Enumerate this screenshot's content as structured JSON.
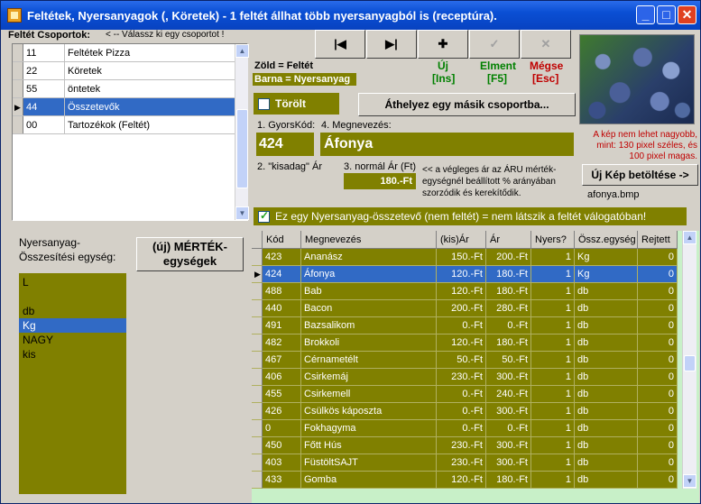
{
  "window": {
    "title": "Feltétek, Nyersanyagok (, Köretek)      - 1 feltét állhat több nyersanyagból is (receptúra).",
    "minimize": "_",
    "maximize": "□",
    "close": "✕"
  },
  "groups": {
    "label": "Feltét Csoportok:",
    "hint": "< -- Válassz ki egy csoportot !",
    "rows": [
      {
        "code": "11",
        "name": "Feltétek Pizza"
      },
      {
        "code": "22",
        "name": "Köretek"
      },
      {
        "code": "55",
        "name": "öntetek"
      },
      {
        "code": "44",
        "name": "Összetevők"
      },
      {
        "code": "00",
        "name": "Tartozékok (Feltét)"
      }
    ],
    "selected_index": 3
  },
  "nav": {
    "first": "|◀",
    "next": "▶|",
    "new": "✚",
    "save": "✓",
    "cancel": "✕"
  },
  "legend": {
    "green": "Zöld = Feltét",
    "brown": "Barna = Nyersanyag"
  },
  "actions": {
    "new_label": "Új",
    "new_key": "[Ins]",
    "save_label": "Elment",
    "save_key": "[F5]",
    "cancel_label": "Mégse",
    "cancel_key": "[Esc]"
  },
  "deleted_label": "Törölt",
  "move_button": "Áthelyez egy másik csoportba...",
  "image_note": "A kép nem lehet nagyobb, mint:  130 pixel széles, és 100 pixel magas.",
  "load_image_button": "Új Kép betöltése ->",
  "image_file": "afonya.bmp",
  "form": {
    "code_label": "1. GyorsKód:",
    "code_value": "424",
    "name_label": "4. Megnevezés:",
    "name_value": "Áfonya",
    "small_price_label": "2. \"kisadag\" Ár",
    "normal_price_label": "3. normál Ár (Ft)",
    "normal_price_value": "180.-Ft",
    "price_note": "<< a végleges ár az ÁRU mérték-egységnél beállított % arányában szorzódik és kerekítődik."
  },
  "raw_material_checkbox": "Ez egy Nyersanyag-összetevő (nem feltét) = nem látszik a feltét válogatóban!",
  "units": {
    "label": "Nyersanyag-Összesítési egység:",
    "button": "(új) MÉRTÉK-egységek",
    "items": [
      "L",
      "",
      "db",
      "Kg",
      "NAGY",
      "kis"
    ],
    "selected_index": 3
  },
  "grid": {
    "columns": [
      "Kód",
      "Megnevezés",
      "(kis)Ár",
      "Ár",
      "Nyers?",
      "Össz.egység",
      "Rejtett"
    ],
    "rows": [
      [
        "423",
        "Ananász",
        "150.-Ft",
        "200.-Ft",
        "1",
        "Kg",
        "0"
      ],
      [
        "424",
        "Áfonya",
        "120.-Ft",
        "180.-Ft",
        "1",
        "Kg",
        "0"
      ],
      [
        "488",
        "Bab",
        "120.-Ft",
        "180.-Ft",
        "1",
        "db",
        "0"
      ],
      [
        "440",
        "Bacon",
        "200.-Ft",
        "280.-Ft",
        "1",
        "db",
        "0"
      ],
      [
        "491",
        "Bazsalikom",
        "0.-Ft",
        "0.-Ft",
        "1",
        "db",
        "0"
      ],
      [
        "482",
        "Brokkoli",
        "120.-Ft",
        "180.-Ft",
        "1",
        "db",
        "0"
      ],
      [
        "467",
        "Cérnametélt",
        "50.-Ft",
        "50.-Ft",
        "1",
        "db",
        "0"
      ],
      [
        "406",
        "Csirkemáj",
        "230.-Ft",
        "300.-Ft",
        "1",
        "db",
        "0"
      ],
      [
        "455",
        "Csirkemell",
        "0.-Ft",
        "240.-Ft",
        "1",
        "db",
        "0"
      ],
      [
        "426",
        "Csülkös káposzta",
        "0.-Ft",
        "300.-Ft",
        "1",
        "db",
        "0"
      ],
      [
        "0",
        "Fokhagyma",
        "0.-Ft",
        "0.-Ft",
        "1",
        "db",
        "0"
      ],
      [
        "450",
        "Főtt Hús",
        "230.-Ft",
        "300.-Ft",
        "1",
        "db",
        "0"
      ],
      [
        "403",
        "FüstöltSAJT",
        "230.-Ft",
        "300.-Ft",
        "1",
        "db",
        "0"
      ],
      [
        "433",
        "Gomba",
        "120.-Ft",
        "180.-Ft",
        "1",
        "db",
        "0"
      ]
    ],
    "selected_index": 1
  },
  "colors": {
    "olive": "#808000",
    "selection": "#316ac5",
    "green_text": "#008000",
    "red_text": "#c00000"
  }
}
